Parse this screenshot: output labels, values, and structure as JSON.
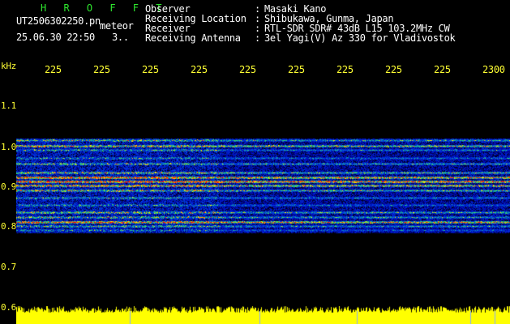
{
  "header": {
    "title": "H R O F F T",
    "filename": "UT2506302250.pn",
    "meteor_label": "meteor",
    "datetime": "25.06.30 22:50",
    "count": "3..",
    "info": [
      {
        "label": "Observer",
        "value": "Masaki Kano"
      },
      {
        "label": "Receiving Location",
        "value": "Shibukawa, Gunma, Japan"
      },
      {
        "label": "Receiver",
        "value": "RTL-SDR SDR# 43dB L15 103.2MHz CW"
      },
      {
        "label": "Receiving Antenna",
        "value": "3el Yagi(V) Az 330 for Vladivostok"
      }
    ]
  },
  "axis": {
    "unit": "kHz",
    "x_ticks": [
      "225",
      "225",
      "225",
      "225",
      "225",
      "225",
      "225",
      "225",
      "225",
      "2300"
    ],
    "y_ticks": [
      "1.1",
      "1.0",
      "0.9",
      "0.8",
      "0.7",
      "0.6"
    ]
  },
  "colors": {
    "label_green": "#2ee62e",
    "tick_yellow": "#ffff33",
    "amplitude_yellow": "#ffff00",
    "noise_blue": "#0a2bd6",
    "hot_red": "#ff2a2a"
  }
}
